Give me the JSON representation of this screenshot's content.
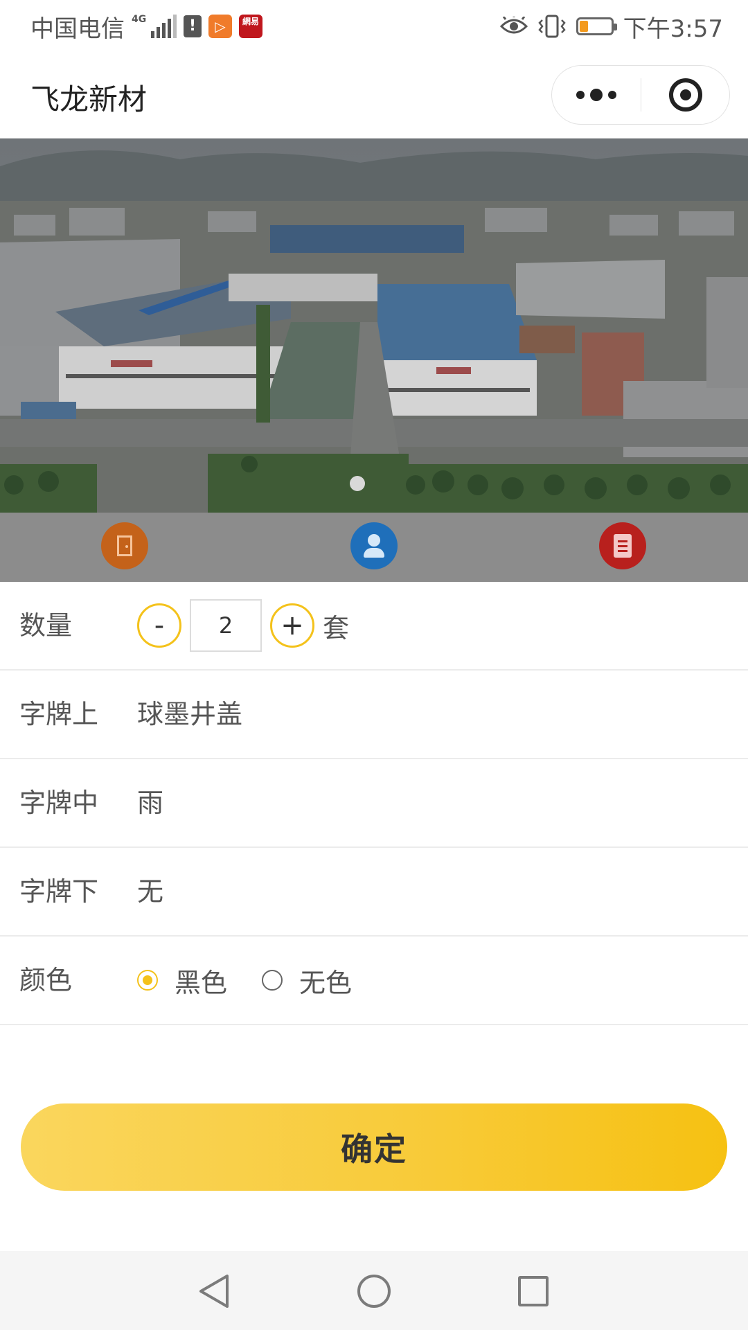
{
  "status_bar": {
    "carrier": "中国电信",
    "network": "4G",
    "alert_badge": "!",
    "time": "下午3:57",
    "battery_level": 0.2,
    "icons": [
      "signal-icon",
      "alert-icon",
      "video-app-icon",
      "netease-app-icon",
      "eye-icon",
      "vibrate-icon",
      "battery-icon"
    ]
  },
  "nav": {
    "title": "飞龙新材",
    "more_icon": "more-dots-icon",
    "close_icon": "target-close-icon"
  },
  "banner": {
    "slide_count": 1,
    "active_slide": 1
  },
  "shortcuts": [
    {
      "icon": "door-icon",
      "color": "#c4621a"
    },
    {
      "icon": "customer-service-icon",
      "color": "#1f6fba"
    },
    {
      "icon": "clipboard-icon",
      "color": "#b8201d"
    }
  ],
  "form": {
    "quantity": {
      "label": "数量",
      "minus": "-",
      "value": "2",
      "plus": "+",
      "unit": "套"
    },
    "sign_top": {
      "label": "字牌上",
      "value": "球墨井盖"
    },
    "sign_middle": {
      "label": "字牌中",
      "value": "雨"
    },
    "sign_bottom": {
      "label": "字牌下",
      "value": "无"
    },
    "color": {
      "label": "颜色",
      "options": [
        {
          "label": "黑色",
          "checked": true
        },
        {
          "label": "无色",
          "checked": false
        }
      ]
    }
  },
  "confirm_button": "确定",
  "colors": {
    "accent": "#f4c21b",
    "button_gradient_start": "#fad65d",
    "button_gradient_end": "#f6c112"
  },
  "system_nav": [
    "back-icon",
    "home-icon",
    "recent-apps-icon"
  ]
}
